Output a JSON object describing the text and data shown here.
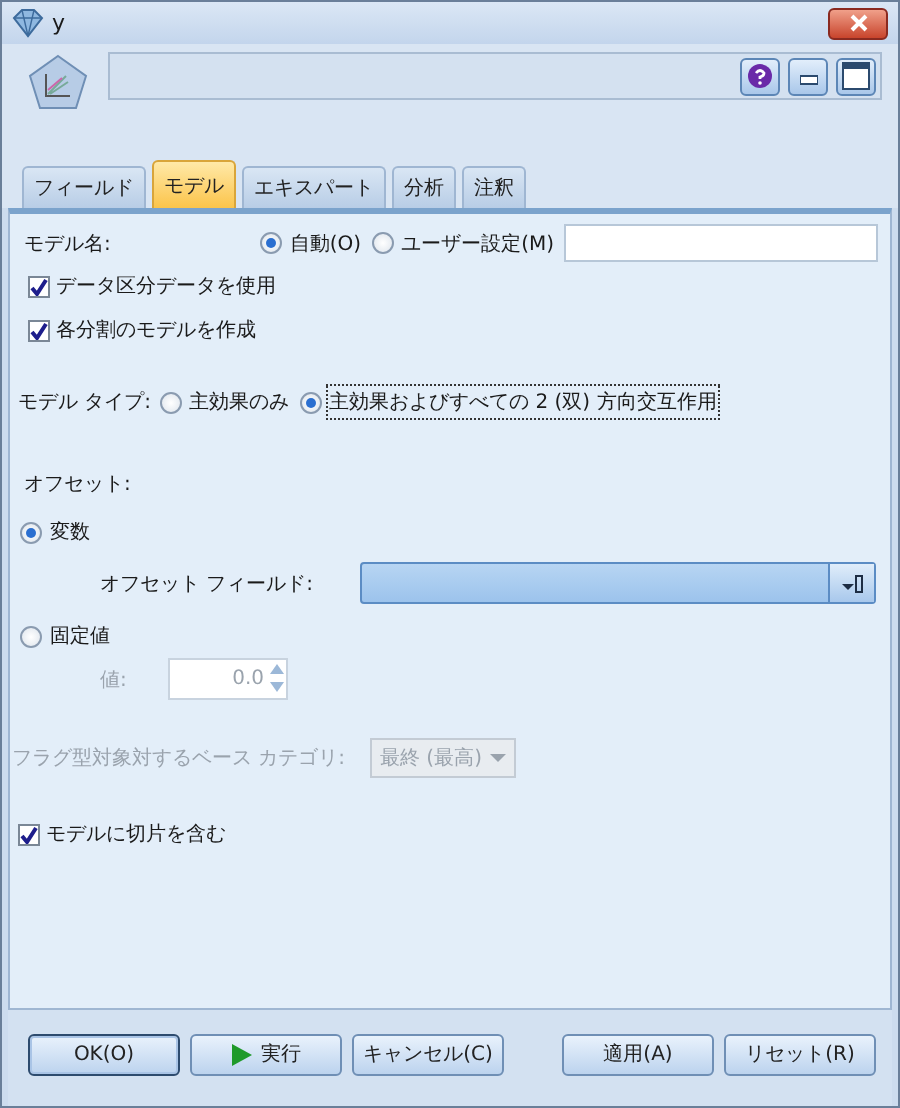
{
  "window": {
    "title": "y"
  },
  "tabs": [
    {
      "label": "フィールド",
      "selected": false
    },
    {
      "label": "モデル",
      "selected": true
    },
    {
      "label": "エキスパート",
      "selected": false
    },
    {
      "label": "分析",
      "selected": false
    },
    {
      "label": "注釈",
      "selected": false
    }
  ],
  "model_name": {
    "label": "モデル名:",
    "options": [
      {
        "label": "自動(O)",
        "selected": true
      },
      {
        "label": "ユーザー設定(M)",
        "selected": false
      }
    ]
  },
  "checkboxes": [
    {
      "label": "データ区分データを使用",
      "checked": true
    },
    {
      "label": "各分割のモデルを作成",
      "checked": true
    }
  ],
  "model_type": {
    "label": "モデル タイプ:",
    "options": [
      {
        "label": "主効果のみ",
        "selected": false
      },
      {
        "label": "主効果およびすべての 2 (双) 方向交互作用",
        "selected": true
      }
    ]
  },
  "offset": {
    "label": "オフセット:",
    "options": [
      {
        "label": "変数",
        "selected": true
      },
      {
        "label": "固定値",
        "selected": false
      }
    ],
    "field_label": "オフセット フィールド:",
    "value_label": "値:",
    "value": "0.0"
  },
  "base_category": {
    "label": "フラグ型対象対するベース カテゴリ:",
    "value": "最終 (最高)",
    "disabled": true
  },
  "intercept": {
    "label": "モデルに切片を含む",
    "checked": true
  },
  "buttons_left": [
    {
      "label": "OK(O)",
      "kind": "default"
    },
    {
      "label": "実行",
      "kind": "run"
    },
    {
      "label": "キャンセル(C)",
      "kind": "plain"
    }
  ],
  "buttons_right": [
    {
      "label": "適用(A)",
      "kind": "plain"
    },
    {
      "label": "リセット(R)",
      "kind": "plain"
    }
  ]
}
